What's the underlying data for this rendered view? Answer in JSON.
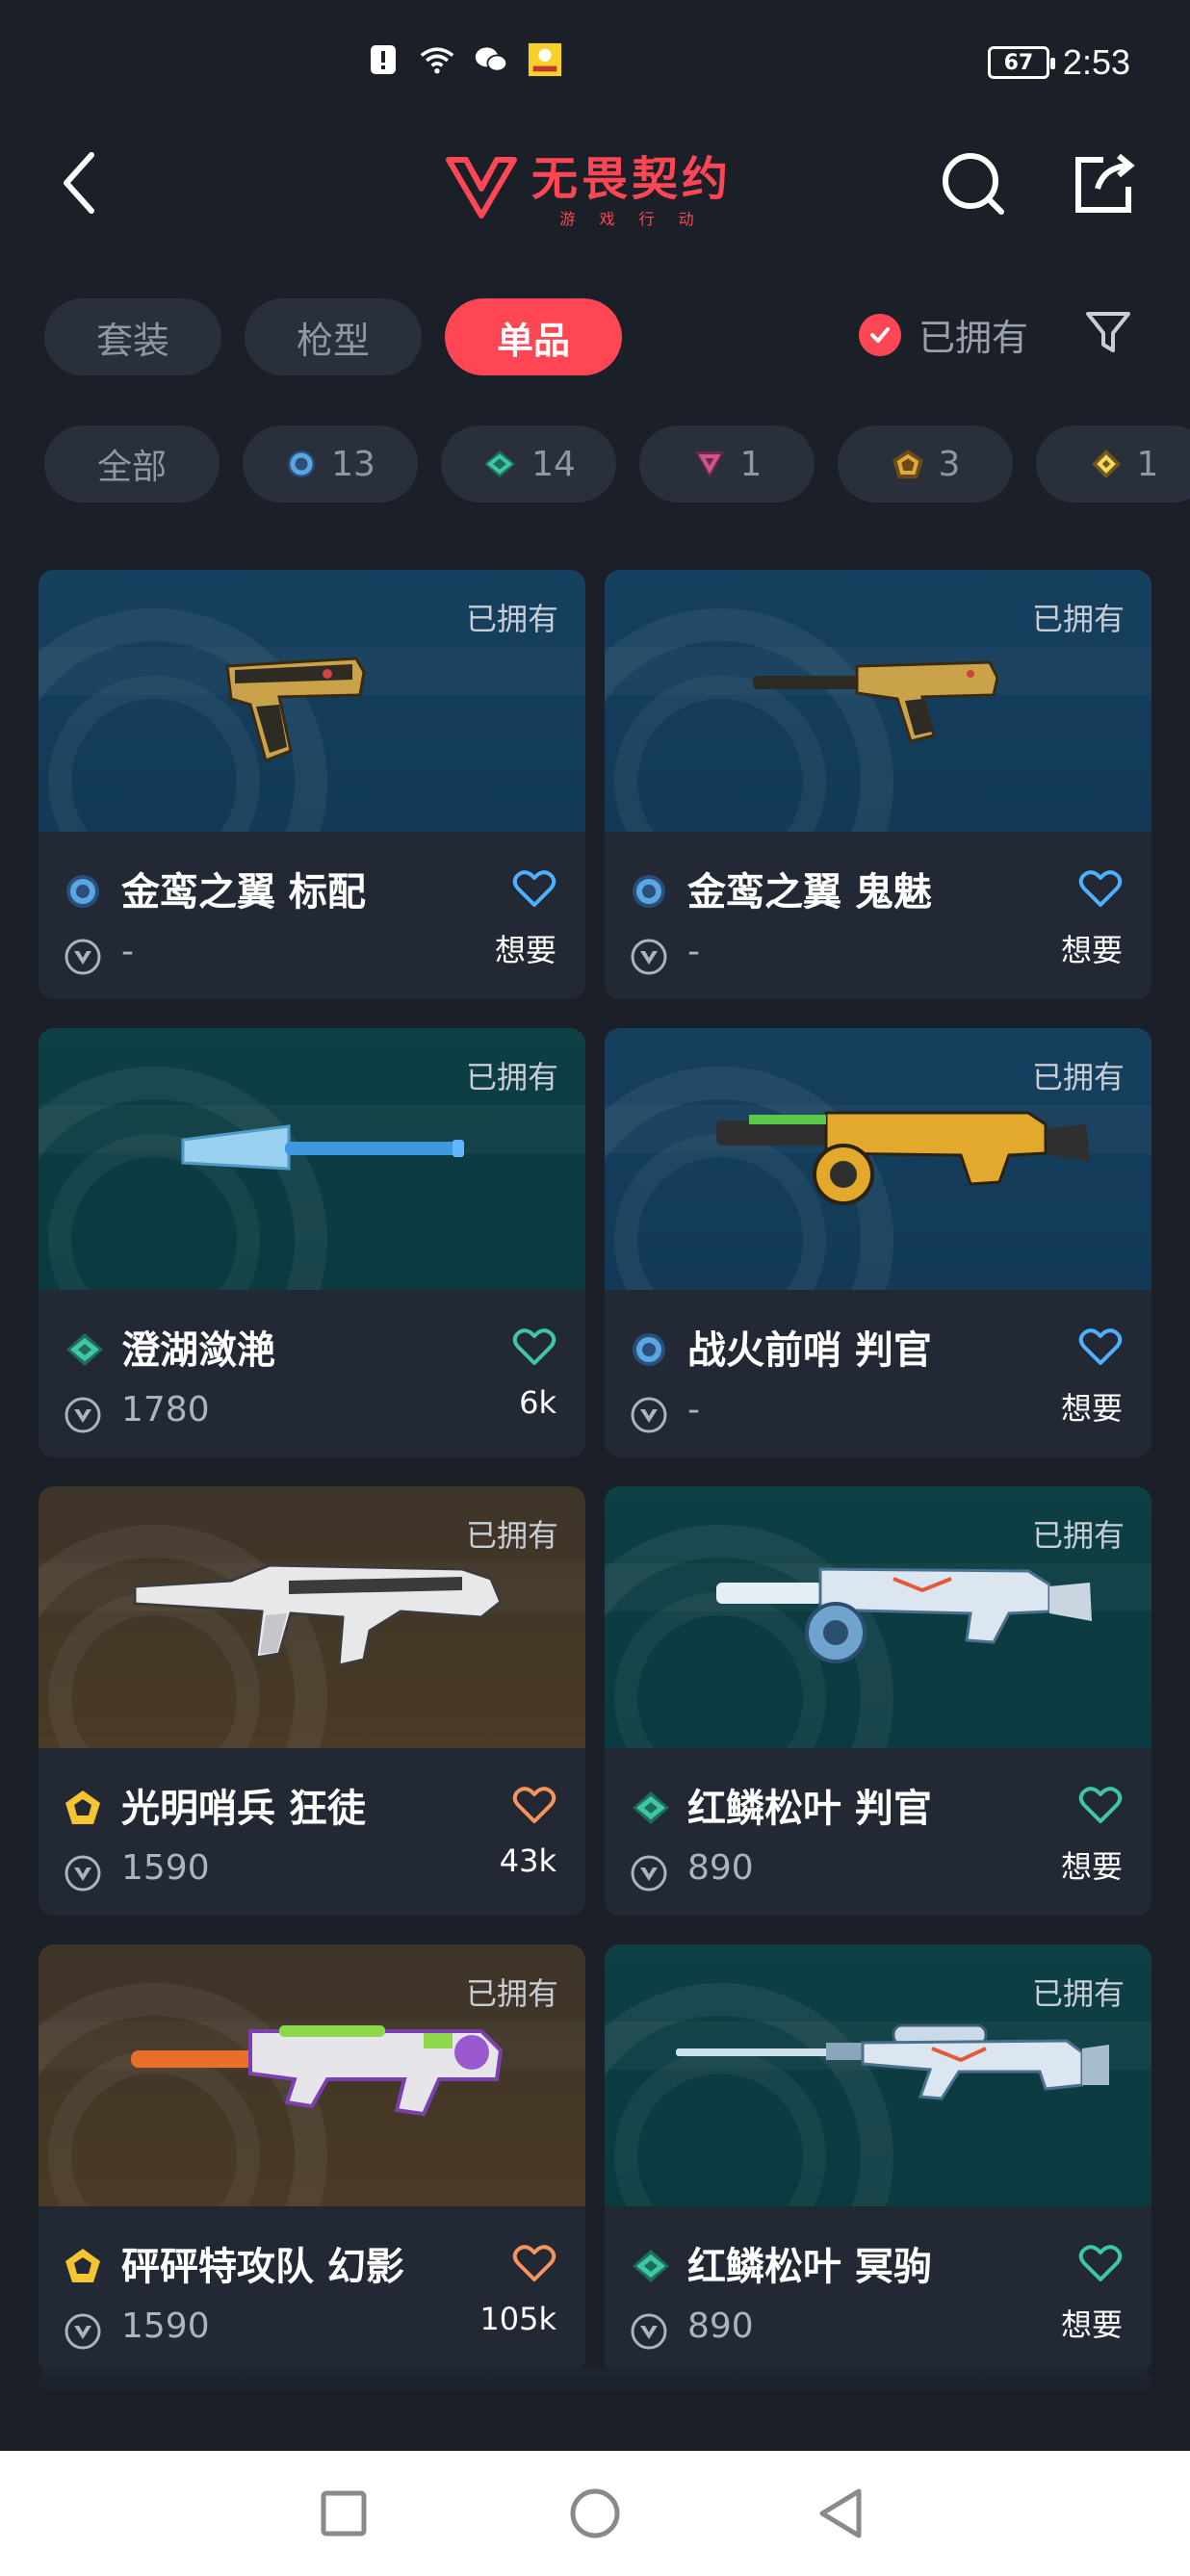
{
  "status_bar": {
    "time": "2:53",
    "battery": "67",
    "icons": [
      "notification-icon",
      "wifi-icon",
      "wechat-icon",
      "app-badge-icon"
    ]
  },
  "header": {
    "logo_title": "无畏契约",
    "logo_subtitle": "游 戏 行 动",
    "icons": [
      "back-icon",
      "search-icon",
      "share-icon"
    ]
  },
  "tabs": [
    {
      "label": "套装",
      "active": false
    },
    {
      "label": "枪型",
      "active": false
    },
    {
      "label": "单品",
      "active": true
    }
  ],
  "owned_filter": {
    "label": "已拥有",
    "checked": true
  },
  "chips": [
    {
      "label": "全部",
      "tier": null
    },
    {
      "label": "13",
      "tier": "select"
    },
    {
      "label": "14",
      "tier": "deluxe"
    },
    {
      "label": "1",
      "tier": "premium"
    },
    {
      "label": "3",
      "tier": "exclusive"
    },
    {
      "label": "1",
      "tier": "ultra"
    }
  ],
  "tier_colors": {
    "select": "#5aa6e0",
    "deluxe": "#3fc7a2",
    "premium": "#d1548e",
    "exclusive": "#f5955b",
    "ultra": "#fad663"
  },
  "cards": [
    {
      "name": "金鸾之翼 标配",
      "tier": "select",
      "bg": "blue",
      "owned_label": "已拥有",
      "price": "-",
      "want": "想要",
      "heart_color": "#4fb0ff",
      "weapon": "pistol"
    },
    {
      "name": "金鸾之翼 鬼魅",
      "tier": "select",
      "bg": "blue",
      "owned_label": "已拥有",
      "price": "-",
      "want": "想要",
      "heart_color": "#4fb0ff",
      "weapon": "silenced-pistol"
    },
    {
      "name": "澄湖潋滟",
      "tier": "deluxe",
      "bg": "teal",
      "owned_label": "已拥有",
      "price": "1780",
      "want": "6k",
      "heart_color": "#3fc7a2",
      "weapon": "fan-knife"
    },
    {
      "name": "战火前哨 判官",
      "tier": "select",
      "bg": "blue",
      "owned_label": "已拥有",
      "price": "-",
      "want": "想要",
      "heart_color": "#4fb0ff",
      "weapon": "shotgun"
    },
    {
      "name": "光明哨兵 狂徒",
      "tier": "exclusive",
      "bg": "gold",
      "owned_label": "已拥有",
      "price": "1590",
      "want": "43k",
      "heart_color": "#f5955b",
      "weapon": "rifle"
    },
    {
      "name": "红鳞松叶 判官",
      "tier": "deluxe",
      "bg": "teal",
      "owned_label": "已拥有",
      "price": "890",
      "want": "想要",
      "heart_color": "#3fc7a2",
      "weapon": "shotgun-white"
    },
    {
      "name": "砰砰特攻队 幻影",
      "tier": "exclusive",
      "bg": "gold",
      "owned_label": "已拥有",
      "price": "1590",
      "want": "105k",
      "heart_color": "#f5955b",
      "weapon": "toy-rifle"
    },
    {
      "name": "红鳞松叶 冥驹",
      "tier": "deluxe",
      "bg": "teal",
      "owned_label": "已拥有",
      "price": "890",
      "want": "想要",
      "heart_color": "#3fc7a2",
      "weapon": "sniper"
    }
  ],
  "nav_bar": {
    "icons": [
      "recent-apps-icon",
      "home-icon",
      "back-nav-icon"
    ]
  }
}
